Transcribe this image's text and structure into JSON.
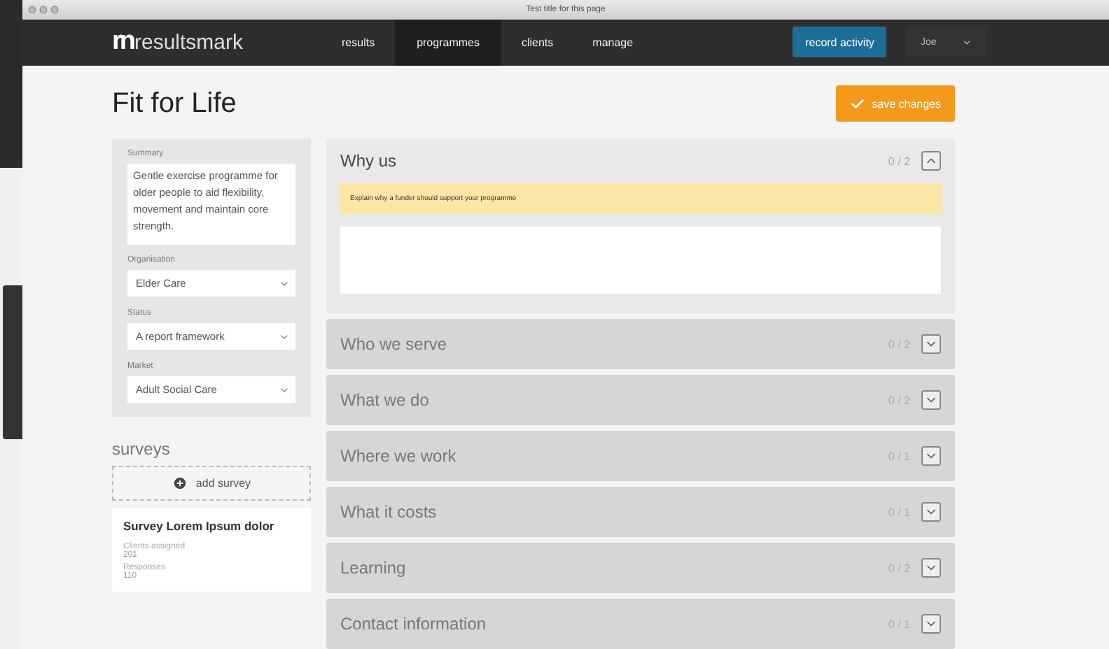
{
  "browser": {
    "title": "Test title for this page"
  },
  "nav": {
    "logo_mark": "rn",
    "logo_text": "resultsmark",
    "items": [
      {
        "label": "results",
        "selected": false
      },
      {
        "label": "programmes",
        "selected": true
      },
      {
        "label": "clients",
        "selected": false
      },
      {
        "label": "manage",
        "selected": false
      }
    ],
    "action": "record activity",
    "user": "Joe"
  },
  "page": {
    "title": "Fit for Life",
    "save": "save changes"
  },
  "details": {
    "summary_label": "Summary",
    "summary": "Gentle exercise programme for older people to aid flexibility, movement and maintain core strength.",
    "selects": [
      {
        "label": "Organisation",
        "value": "Elder Care"
      },
      {
        "label": "Status",
        "value": "A report framework"
      },
      {
        "label": "Market",
        "value": "Adult Social Care"
      }
    ]
  },
  "surveys": {
    "heading": "surveys",
    "add": "add survey",
    "card": {
      "title": "Survey Lorem Ipsum dolor",
      "stats": [
        {
          "label": "Clients assigned",
          "value": "201"
        },
        {
          "label": "Responses",
          "value": "110"
        }
      ]
    }
  },
  "sections": [
    {
      "title": "Why us",
      "count": "0 / 2",
      "expanded": true,
      "hint": "Explain why a funder should support your programme"
    },
    {
      "title": "Who we serve",
      "count": "0 / 2",
      "expanded": false
    },
    {
      "title": "What we do",
      "count": "0 / 2",
      "expanded": false
    },
    {
      "title": "Where we work",
      "count": "0 / 1",
      "expanded": false
    },
    {
      "title": "What it costs",
      "count": "0 / 1",
      "expanded": false
    },
    {
      "title": "Learning",
      "count": "0 / 2",
      "expanded": false
    },
    {
      "title": "Contact information",
      "count": "0 / 1",
      "expanded": false
    }
  ]
}
